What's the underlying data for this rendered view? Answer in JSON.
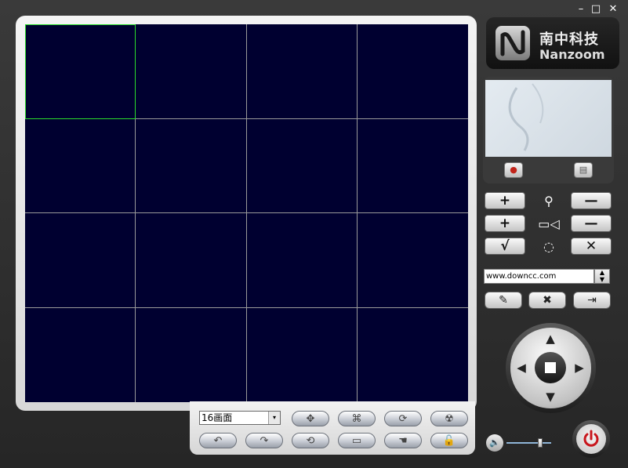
{
  "window_controls": {
    "minimize": "–",
    "maximize": "□",
    "close": "✕"
  },
  "logo": {
    "cn": "南中科技",
    "en": "Nanzoom"
  },
  "video_grid": {
    "rows": 4,
    "cols": 4,
    "selected_cell": 0
  },
  "layout_select": {
    "value": "16画面",
    "arrow": "▾"
  },
  "toolbar_row1": [
    {
      "name": "move-icon",
      "glyph": "✥"
    },
    {
      "name": "fullscreen-icon",
      "glyph": "⌘"
    },
    {
      "name": "cycle-icon",
      "glyph": "⟳"
    },
    {
      "name": "radiation-icon",
      "glyph": "☢"
    }
  ],
  "toolbar_row2": [
    {
      "name": "undo-icon",
      "glyph": "↶"
    },
    {
      "name": "redo-icon",
      "glyph": "↷"
    },
    {
      "name": "refresh-icon",
      "glyph": "⟲"
    },
    {
      "name": "monitor-icon",
      "glyph": "▭"
    },
    {
      "name": "hand-icon",
      "glyph": "☚"
    },
    {
      "name": "unlock-icon",
      "glyph": "🔓"
    }
  ],
  "preview": {
    "record_icon": "●",
    "snapshot_icon": "▤"
  },
  "controls": {
    "zoom": {
      "plus": "+",
      "icon": "⚲",
      "minus": "—"
    },
    "camera": {
      "plus": "+",
      "icon": "▭◁",
      "minus": "—"
    },
    "confirm": {
      "ok": "√",
      "icon": "◌",
      "cancel": "✕"
    }
  },
  "preset_input": {
    "value": "www.downcc.com"
  },
  "spinner": {
    "up": "▲",
    "down": "▼"
  },
  "actions": {
    "edit": "✎",
    "delete": "✖",
    "login": "⇥"
  },
  "ptz": {
    "up": "▲",
    "down": "▼",
    "left": "◀",
    "right": "▶"
  },
  "volume": {
    "icon": "🔈",
    "level": 0.75
  },
  "power": {
    "glyph": "⏻"
  }
}
